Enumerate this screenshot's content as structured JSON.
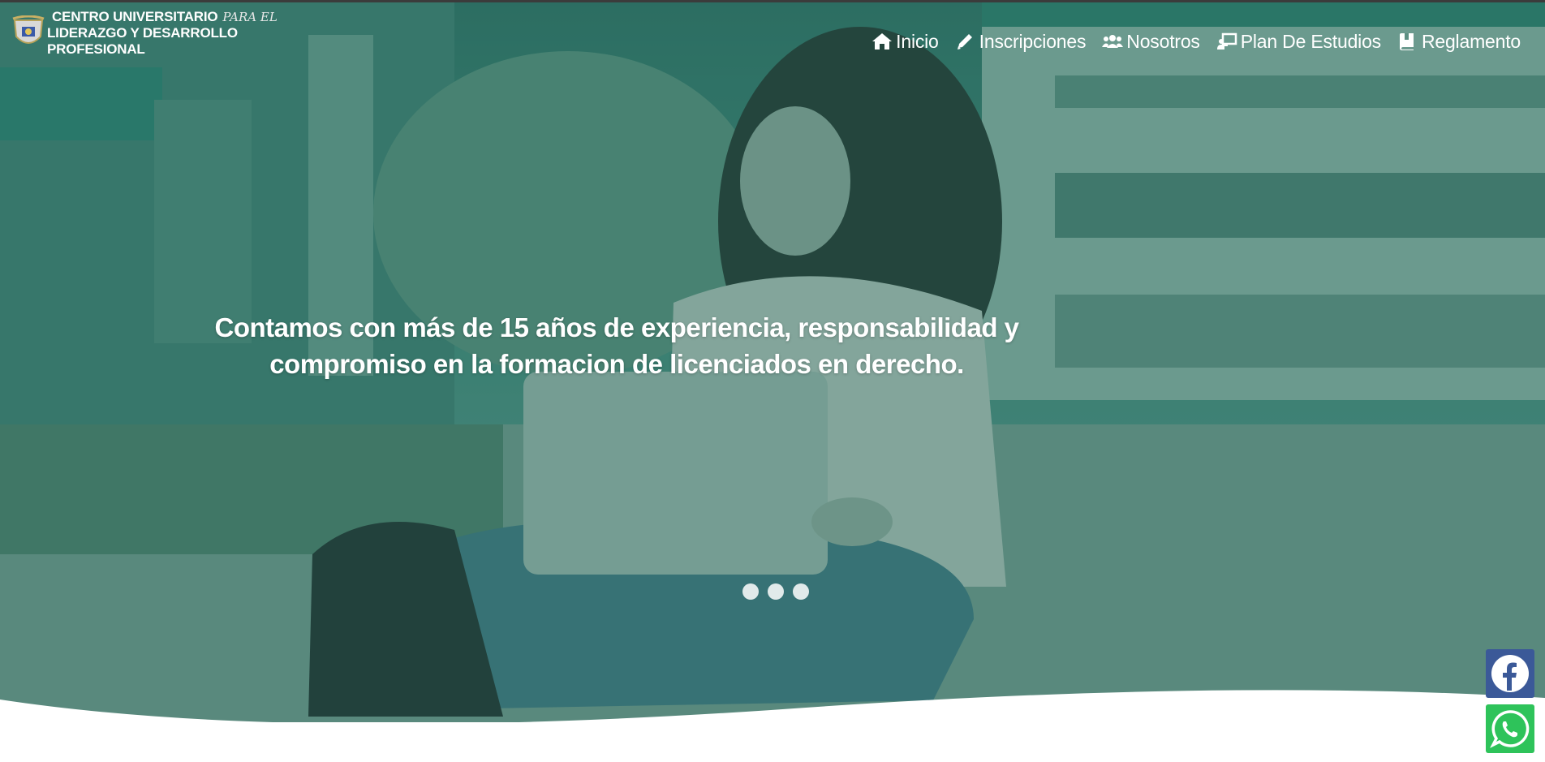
{
  "header": {
    "logo": {
      "line1": "CENTRO UNIVERSITARIO",
      "line1_script": "PARA EL",
      "line2": "LIDERAZGO Y DESARROLLO PROFESIONAL"
    },
    "nav": [
      {
        "label": "Inicio",
        "icon": "home-icon"
      },
      {
        "label": "Inscripciones",
        "icon": "pencil-icon"
      },
      {
        "label": "Nosotros",
        "icon": "users-icon"
      },
      {
        "label": "Plan De Estudios",
        "icon": "chalkboard-teacher-icon"
      },
      {
        "label": "Reglamento",
        "icon": "book-icon"
      }
    ]
  },
  "hero": {
    "headline_line1": "Contamos con más de 15 años de experiencia, responsabilidad y",
    "headline_line2": "compromiso en la formacion de licenciados en derecho.",
    "slides": 3,
    "overlay_color": "#2e7a6a"
  },
  "social": {
    "facebook_color": "#3b5998",
    "whatsapp_color": "#2ec35a"
  }
}
